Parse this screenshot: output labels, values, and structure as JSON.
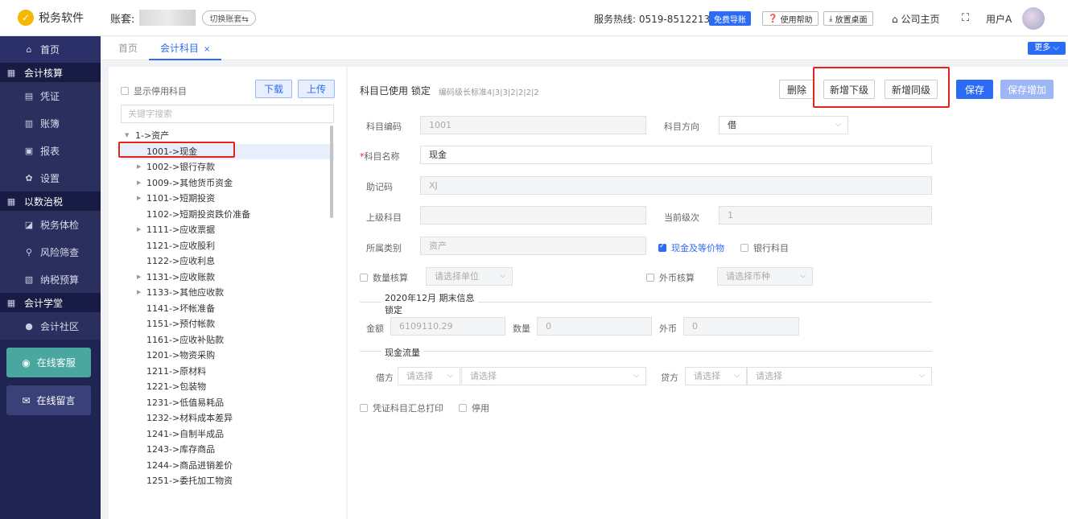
{
  "sidebar": {
    "brand": "税务软件",
    "home": "首页",
    "groups": [
      {
        "title": "会计核算",
        "items": [
          "凭证",
          "账簿",
          "报表",
          "设置"
        ]
      },
      {
        "title": "以数治税",
        "items": [
          "税务体检",
          "风险筛查",
          "纳税预算"
        ]
      },
      {
        "title": "会计学堂",
        "items": [
          "会计社区"
        ]
      }
    ],
    "online_service": "在线客服",
    "online_message": "在线留言"
  },
  "header": {
    "account_label": "账套:",
    "switch_account": "切换账套⇆",
    "hotline": "服务热线: 0519-85122137",
    "free_nav": "免费导账",
    "help": "使用帮助",
    "desktop": "放置桌面",
    "company_home": "公司主页",
    "user": "用户A"
  },
  "tabs": {
    "home": "首页",
    "current": "会计科目",
    "close": "×",
    "more": "更多 ⌵"
  },
  "tree": {
    "show_disabled": "显示停用科目",
    "download": "下载",
    "upload": "上传",
    "search_placeholder": "关键字搜索",
    "root": "1->资产",
    "items": [
      {
        "label": "1001->现金",
        "expandable": false,
        "selected": true
      },
      {
        "label": "1002->银行存款",
        "expandable": true
      },
      {
        "label": "1009->其他货币资金",
        "expandable": true
      },
      {
        "label": "1101->短期投资",
        "expandable": true
      },
      {
        "label": "1102->短期投资跌价准备",
        "expandable": false
      },
      {
        "label": "1111->应收票据",
        "expandable": true
      },
      {
        "label": "1121->应收股利",
        "expandable": false
      },
      {
        "label": "1122->应收利息",
        "expandable": false
      },
      {
        "label": "1131->应收账款",
        "expandable": true
      },
      {
        "label": "1133->其他应收款",
        "expandable": true
      },
      {
        "label": "1141->坏帐准备",
        "expandable": false
      },
      {
        "label": "1151->预付帐款",
        "expandable": false
      },
      {
        "label": "1161->应收补贴款",
        "expandable": false
      },
      {
        "label": "1201->物资采购",
        "expandable": false
      },
      {
        "label": "1211->原材料",
        "expandable": false
      },
      {
        "label": "1221->包装物",
        "expandable": false
      },
      {
        "label": "1231->低值易耗品",
        "expandable": false
      },
      {
        "label": "1232->材料成本差异",
        "expandable": false
      },
      {
        "label": "1241->自制半成品",
        "expandable": false
      },
      {
        "label": "1243->库存商品",
        "expandable": false
      },
      {
        "label": "1244->商品进销差价",
        "expandable": false
      },
      {
        "label": "1251->委托加工物资",
        "expandable": false
      }
    ]
  },
  "form": {
    "title": "科目已使用 锁定",
    "code_rule": "编码级长标准4|3|3|2|2|2|2",
    "delete": "删除",
    "add_sub": "新增下级",
    "add_same": "新增同级",
    "save": "保存",
    "save_add": "保存增加",
    "code_label": "科目编码",
    "code_value": "1001",
    "direction_label": "科目方向",
    "direction_value": "借",
    "name_label": "科目名称",
    "name_value": "现金",
    "mnemonic_label": "助记码",
    "mnemonic_value": "XJ",
    "parent_label": "上级科目",
    "parent_value": "",
    "level_label": "当前级次",
    "level_value": "1",
    "category_label": "所属类别",
    "category_value": "资产",
    "cash_equiv": "现金及等价物",
    "bank_subject": "银行科目",
    "qty_calc": "数量核算",
    "unit_placeholder": "请选择单位",
    "fx_calc": "外币核算",
    "currency_placeholder": "请选择币种",
    "period_title_1": "2020年12月 期末信息",
    "period_title_2": "锁定",
    "amount_label": "金额",
    "amount_value": "6109110.29",
    "qty_label": "数量",
    "qty_value": "0",
    "fx_label": "外币",
    "fx_value": "0",
    "cashflow_title": "现金流量",
    "debit_label": "借方",
    "credit_label": "贷方",
    "select_placeholder": "请选择",
    "print_summary": "凭证科目汇总打印",
    "disable": "停用"
  }
}
